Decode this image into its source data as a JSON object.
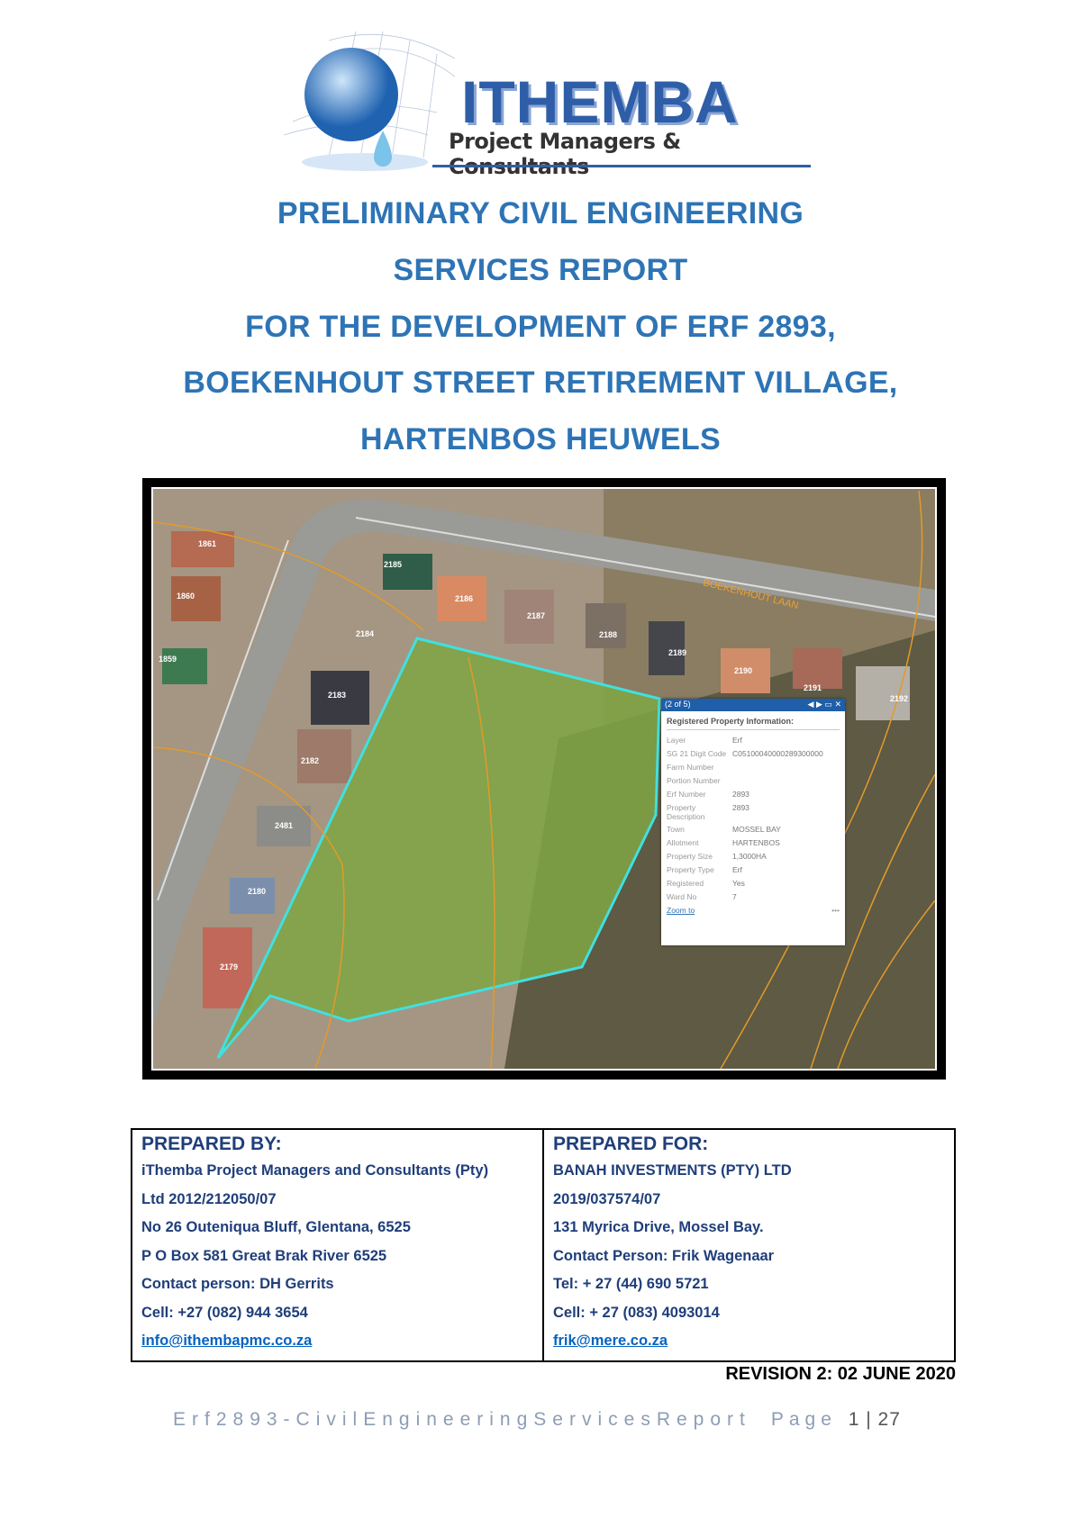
{
  "logo": {
    "name": "ITHEMBA",
    "tagline": "Project Managers & Consultants"
  },
  "title_lines": [
    "PRELIMINARY CIVIL ENGINEERING",
    "SERVICES REPORT",
    "FOR THE DEVELOPMENT OF ERF 2893,",
    "BOEKENHOUT STREET RETIREMENT VILLAGE,",
    "HARTENBOS HEUWELS"
  ],
  "map": {
    "street_label": "BOEKENHOUT LAAN",
    "erf_labels": [
      "1861",
      "1860",
      "1859",
      "2185",
      "2186",
      "2187",
      "2184",
      "2188",
      "2189",
      "2190",
      "2191",
      "2192",
      "2183",
      "2182",
      "2481",
      "2180",
      "2179"
    ],
    "popup": {
      "counter": "(2 of 5)",
      "title": "Registered Property Information:",
      "fields": [
        {
          "k": "Layer",
          "v": "Erf"
        },
        {
          "k": "SG 21 Digit Code",
          "v": "C05100040000289300000"
        },
        {
          "k": "Farm Number",
          "v": ""
        },
        {
          "k": "Portion Number",
          "v": ""
        },
        {
          "k": "Erf Number",
          "v": "2893"
        },
        {
          "k": "Property Description",
          "v": "2893"
        },
        {
          "k": "Town",
          "v": "MOSSEL BAY"
        },
        {
          "k": "Allotment",
          "v": "HARTENBOS"
        },
        {
          "k": "Property Size",
          "v": "1,3000HA"
        },
        {
          "k": "Property Type",
          "v": "Erf"
        },
        {
          "k": "Registered",
          "v": "Yes"
        },
        {
          "k": "Ward No",
          "v": "7"
        }
      ],
      "zoom_link": "Zoom to",
      "more": "•••"
    }
  },
  "prepared_by": {
    "heading": "PREPARED BY:",
    "lines": [
      "iThemba Project Managers and Consultants (Pty)",
      "Ltd 2012/212050/07",
      "No 26 Outeniqua Bluff, Glentana, 6525",
      "P O Box 581 Great Brak River 6525",
      "Contact person: DH Gerrits",
      "Cell: +27 (082) 944 3654"
    ],
    "email": "info@ithembapmc.co.za"
  },
  "prepared_for": {
    "heading": "PREPARED FOR:",
    "lines": [
      "BANAH INVESTMENTS (PTY) LTD",
      "2019/037574/07",
      "131 Myrica Drive, Mossel Bay.",
      "Contact Person: Frik Wagenaar",
      "Tel:  + 27 (44) 690 5721",
      "Cell: + 27 (083) 4093014"
    ],
    "email": "frik@mere.co.za"
  },
  "revision": "REVISION 2: 02 JUNE 2020",
  "footer": {
    "doc": "Erf2893-CivilEngineeringServicesReport",
    "page_label": "Page",
    "page": "1 | 27"
  }
}
